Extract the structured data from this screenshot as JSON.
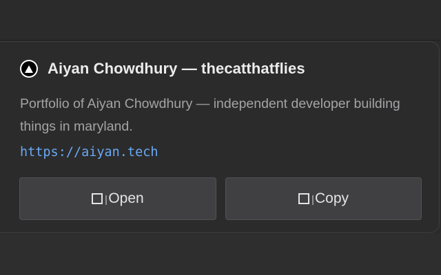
{
  "card": {
    "title": "Aiyan Chowdhury — thecatthatflies",
    "description": "Portfolio of Aiyan Chowdhury — independent developer building things in maryland.",
    "url": "https://aiyan.tech",
    "buttons": {
      "open_label": "Open",
      "copy_label": "Copy"
    }
  },
  "icons": {
    "logo": "triangle-logo-icon",
    "open": "open-window-icon",
    "copy": "copy-icon"
  },
  "colors": {
    "background": "#2b2b2c",
    "title": "#ececec",
    "description": "#a4a4a6",
    "link": "#6aa9f2",
    "button": "#404042"
  }
}
